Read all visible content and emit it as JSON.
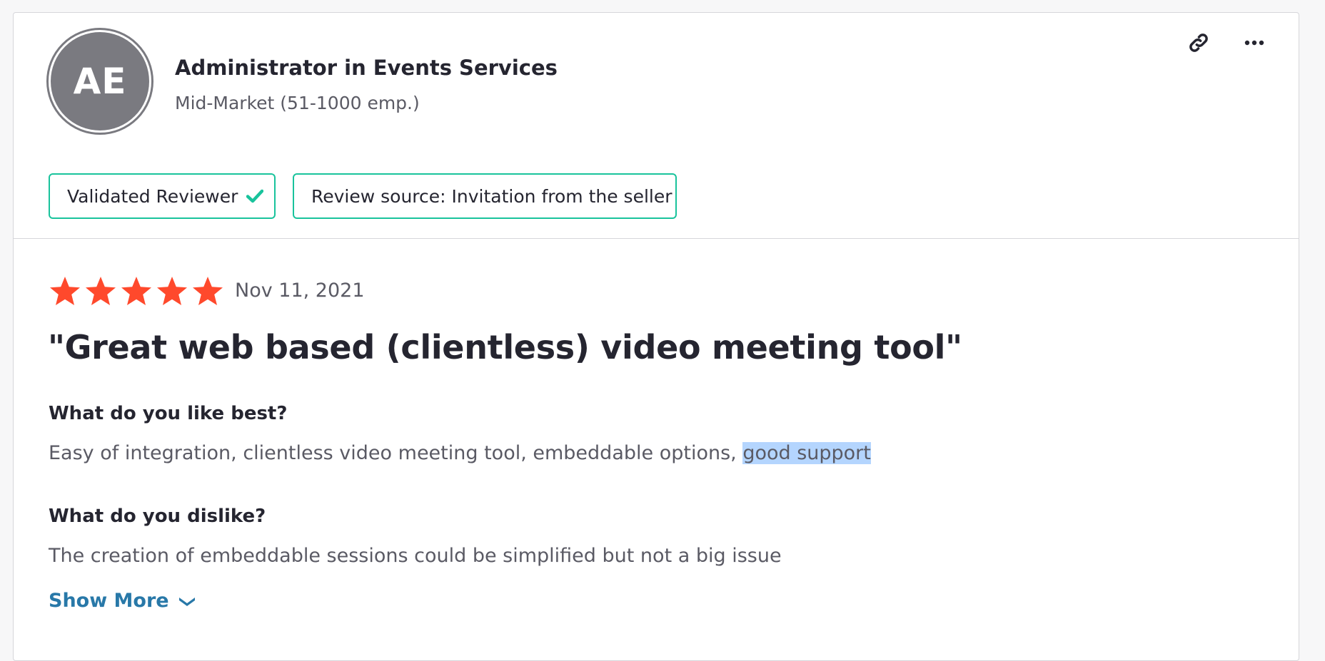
{
  "reviewer": {
    "initials": "AE",
    "title": "Administrator in Events Services",
    "company_size": "Mid-Market (51-1000 emp.)"
  },
  "badges": {
    "validated": "Validated Reviewer",
    "source": "Review source: Invitation from the seller"
  },
  "review": {
    "rating": 5,
    "date": "Nov 11, 2021",
    "title": "\"Great web based (clientless) video meeting tool\"",
    "q1": {
      "label": "What do you like best?",
      "answer_plain": "Easy of integration, clientless video meeting tool, embeddable options, ",
      "answer_highlight": "good support"
    },
    "q2": {
      "label": "What do you dislike?",
      "answer": "The creation of embeddable sessions could be simplified but not a big issue"
    },
    "show_more": "Show More"
  },
  "colors": {
    "star": "#ff492c",
    "badge_border": "#19c39c",
    "link": "#2878a8",
    "highlight": "#b4d5fe",
    "avatar": "#7a7a80"
  },
  "icons": {
    "link": "link-icon",
    "more": "more-icon",
    "check": "check-icon",
    "star": "star-icon",
    "chevron": "chevron-down-icon"
  }
}
